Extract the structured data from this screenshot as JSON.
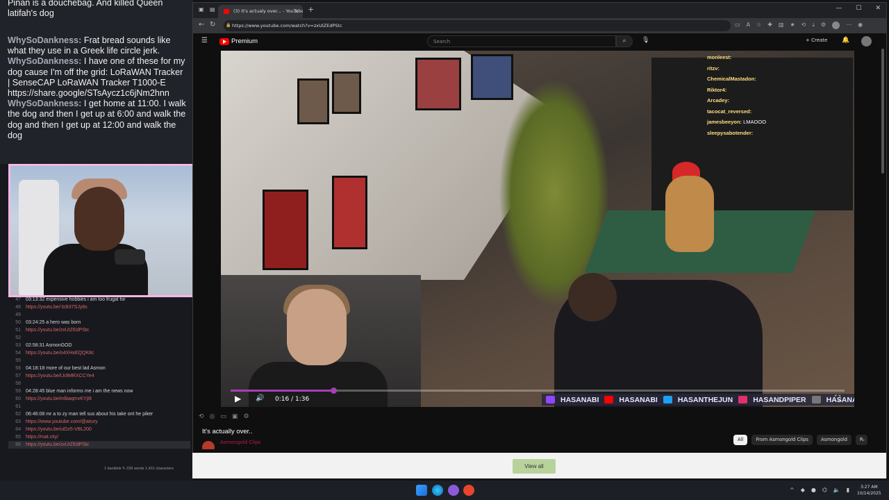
{
  "chat_overlay": {
    "top_cutoff": "Pinan is a douchebag. And killed Queen latifah's dog",
    "messages": [
      {
        "user": "WhySoDankness:",
        "text": "Frat bread sounds like what they use in a Greek life circle jerk."
      },
      {
        "user": "WhySoDankness:",
        "text": "I have one of these for my dog cause I'm off the grid: LoRaWAN Tracker  | SenseCAP LoRaWAN Tracker T1000-E https://share.google/STsAycz1c6jNm2hnn"
      },
      {
        "user": "WhySoDankness:",
        "text": "I get home at 11:00. I walk the dog and then I get up at 6:00 and walk the dog and then I get up at 12:00 and walk the dog"
      }
    ]
  },
  "notes": {
    "rows": [
      {
        "n": "47",
        "text": "03:13:32 expensive hobbies i am too frugal for",
        "link": false
      },
      {
        "n": "48",
        "text": "https://youtu.be/-b3t37SJy8s",
        "link": true
      },
      {
        "n": "49",
        "text": "",
        "link": false
      },
      {
        "n": "50",
        "text": "03:24:25 a hero was born",
        "link": false
      },
      {
        "n": "51",
        "text": "https://youtu.be/zxUIZEdPStc",
        "link": true
      },
      {
        "n": "52",
        "text": "",
        "link": false
      },
      {
        "n": "53",
        "text": "02:58:31  AsmonGOD",
        "link": false
      },
      {
        "n": "54",
        "text": "https://youtu.be/o4XHxEQQK8c",
        "link": true
      },
      {
        "n": "55",
        "text": "",
        "link": false
      },
      {
        "n": "56",
        "text": "04:18:18 more of our best lad Asmon",
        "link": false
      },
      {
        "n": "57",
        "text": "https://youtu.be/Lk9MRXCCYe4",
        "link": true
      },
      {
        "n": "58",
        "text": "",
        "link": false
      },
      {
        "n": "59",
        "text": "04:28:45  blue man informs me i am the news now",
        "link": false
      },
      {
        "n": "60",
        "text": "https://youtu.be/mlbaqmvKYjI8",
        "link": true
      },
      {
        "n": "61",
        "text": "",
        "link": false
      },
      {
        "n": "62",
        "text": "06:46:08  mr a to zy man tell sus about his take ont he piker",
        "link": false
      },
      {
        "n": "63",
        "text": "https://www.youtube.com/@atozy",
        "link": true
      },
      {
        "n": "64",
        "text": "https://youtu.be/uiDz5-VBL200",
        "link": true
      },
      {
        "n": "65",
        "text": "https://mat.city/",
        "link": true
      },
      {
        "n": "66",
        "text": "https://youtu.be/zxUIZEdPStc",
        "link": true
      }
    ],
    "status": "1 backlink  ✎  239 words  1,431 characters"
  },
  "browser": {
    "tab_title": "(3) It's actualy over... - YouTube",
    "url": "https://www.youtube.com/watch?v=zxUIZEdPStc"
  },
  "youtube": {
    "logo": "Premium",
    "search_placeholder": "Search",
    "create": "Create",
    "player": {
      "time": "0:16 / 1:36",
      "progress_fraction": 0.167,
      "socials": [
        "HASANABI",
        "HASANABI",
        "HASANTHEJUN",
        "HASANDPIPER",
        "HASANABI"
      ],
      "stream_chat": [
        {
          "user": "monleest:",
          "text": ""
        },
        {
          "user": "ritzv:",
          "text": ""
        },
        {
          "user": "ChemicalMastadon:",
          "text": ""
        },
        {
          "user": "Riktor4:",
          "text": ""
        },
        {
          "user": "Arcadey:",
          "text": ""
        },
        {
          "user": "tacocat_reversed:",
          "text": ""
        },
        {
          "user": "jamesbeeyon:",
          "text": "LMAOOO"
        },
        {
          "user": "sleepysabotender:",
          "text": ""
        }
      ]
    },
    "video_title": "It's actually over..",
    "channel": "Asmongold Clips",
    "chips": [
      "All",
      "From Asmongold Clips",
      "Asmongold",
      "R"
    ]
  },
  "view_all": "View all",
  "clock": {
    "time": "3:27 AM",
    "date": "10/14/2025"
  },
  "colors": {
    "accent_progress": "#a63fb6",
    "webcam_border": "#f4b7e4",
    "link": "#d96767"
  }
}
